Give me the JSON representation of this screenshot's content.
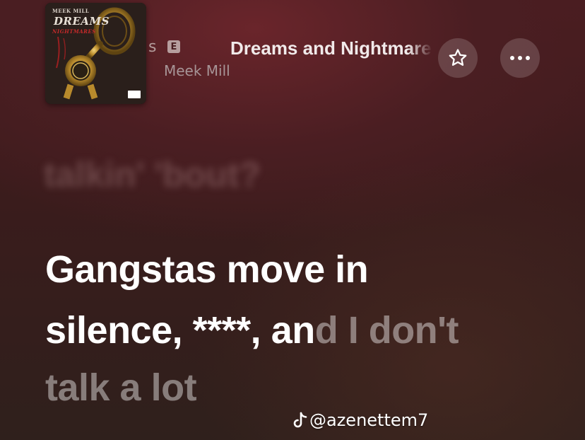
{
  "album_art": {
    "label_top": "MEEK MILL",
    "label_title": "DREAMS",
    "label_subtitle": "NIGHTMARES"
  },
  "header": {
    "song_title_fragment": "s",
    "explicit_badge": "E",
    "album_title": "Dreams and Nightmares",
    "artist": "Meek Mill"
  },
  "buttons": {
    "favorite_icon": "star-outline-icon",
    "more_icon": "ellipsis-icon"
  },
  "lyrics": {
    "previous_line": "talkin' 'bout?",
    "line1": "Gangstas move in",
    "line2_sung": "silence, ****, an",
    "line2_unsung": "d I don't",
    "line3": "talk a lot"
  },
  "watermark": {
    "icon": "tiktok-icon",
    "handle": "@azenettem7"
  },
  "colors": {
    "background": "#3d1c1f",
    "active_lyric": "#ffffff",
    "inactive_lyric": "rgba(255,255,255,0.42)"
  }
}
